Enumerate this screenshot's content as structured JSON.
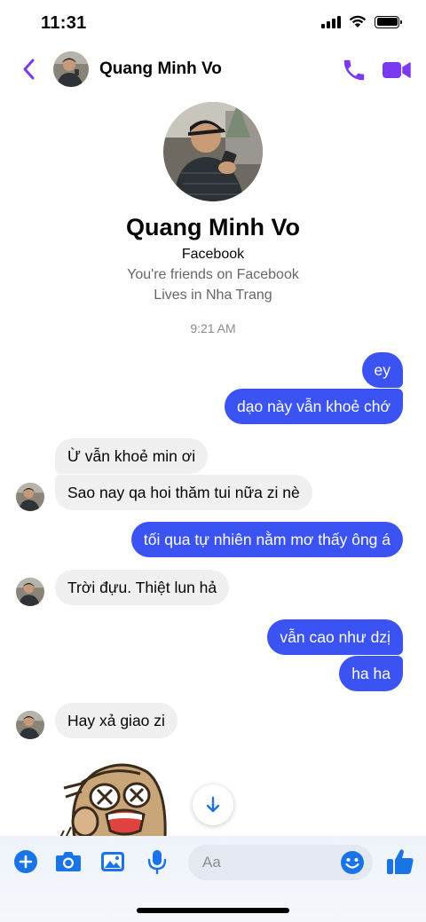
{
  "status": {
    "time": "11:31"
  },
  "header": {
    "name": "Quang Minh Vo"
  },
  "profile": {
    "name": "Quang Minh Vo",
    "source": "Facebook",
    "friends": "You're friends on Facebook",
    "lives": "Lives in Nha Trang"
  },
  "timestamp": "9:21 AM",
  "messages": [
    {
      "from": "me",
      "text": "ey"
    },
    {
      "from": "me",
      "text": "dạo này vẫn khoẻ chớ"
    },
    {
      "from": "them",
      "text": "Ừ vẫn khoẻ min ơi"
    },
    {
      "from": "them",
      "text": "Sao nay qa hoi thăm tui nữa zi nè"
    },
    {
      "from": "me",
      "text": "tối qua tự nhiên nằm mơ thấy ông á"
    },
    {
      "from": "them",
      "text": "Trời đựu. Thiệt lun hả"
    },
    {
      "from": "me",
      "text": "vẫn cao như dzị"
    },
    {
      "from": "me",
      "text": "ha ha"
    },
    {
      "from": "them",
      "text": "Hay xả giao zi"
    }
  ],
  "composer": {
    "placeholder": "Aa"
  },
  "colors": {
    "accent": "#7b3af2",
    "outgoing_bubble": "#3a53f2",
    "incoming_bubble": "#f0f0f0",
    "icon_blue": "#1a74e8"
  },
  "icons": [
    "back-chevron-icon",
    "phone-icon",
    "video-camera-icon",
    "plus-icon",
    "camera-icon",
    "gallery-icon",
    "microphone-icon",
    "emoji-icon",
    "thumbs-up-icon",
    "arrow-down-icon"
  ]
}
